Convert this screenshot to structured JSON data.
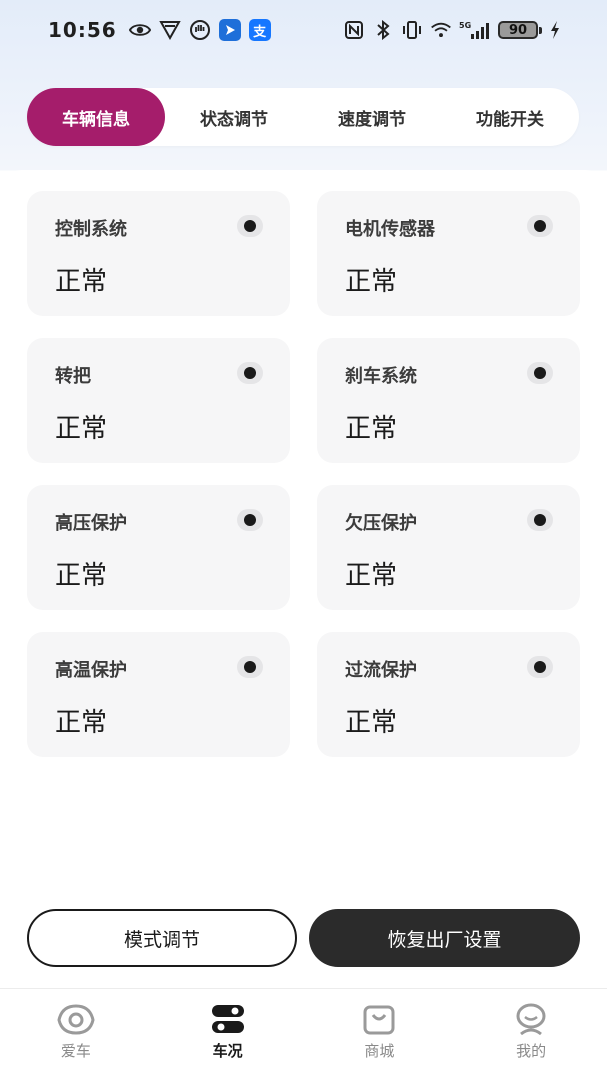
{
  "status_bar": {
    "time": "10:56",
    "battery": "90",
    "network": "5G",
    "icons_left": [
      "eye-icon",
      "vpn-shield-icon",
      "hand-icon",
      "app-arrow-icon",
      "alipay-icon"
    ],
    "alipay_glyph": "支",
    "icons_right": [
      "nfc-icon",
      "bluetooth-icon",
      "vibrate-icon",
      "wifi-icon",
      "signal-icon",
      "charging-icon"
    ]
  },
  "tabs": [
    {
      "label": "车辆信息",
      "active": true
    },
    {
      "label": "状态调节",
      "active": false
    },
    {
      "label": "速度调节",
      "active": false
    },
    {
      "label": "功能开关",
      "active": false
    }
  ],
  "cards": [
    {
      "title": "控制系统",
      "value": "正常"
    },
    {
      "title": "电机传感器",
      "value": "正常"
    },
    {
      "title": "转把",
      "value": "正常"
    },
    {
      "title": "刹车系统",
      "value": "正常"
    },
    {
      "title": "高压保护",
      "value": "正常"
    },
    {
      "title": "欠压保护",
      "value": "正常"
    },
    {
      "title": "高温保护",
      "value": "正常"
    },
    {
      "title": "过流保护",
      "value": "正常"
    }
  ],
  "buttons": {
    "mode": "模式调节",
    "reset": "恢复出厂设置"
  },
  "nav": [
    {
      "label": "爱车",
      "icon": "car-eye-icon",
      "active": false
    },
    {
      "label": "车况",
      "icon": "status-toggle-icon",
      "active": true
    },
    {
      "label": "商城",
      "icon": "shopping-bag-icon",
      "active": false
    },
    {
      "label": "我的",
      "icon": "profile-icon",
      "active": false
    }
  ],
  "colors": {
    "accent": "#a51d6b",
    "dark_button": "#2b2b2b",
    "card_bg": "#f6f6f7"
  }
}
